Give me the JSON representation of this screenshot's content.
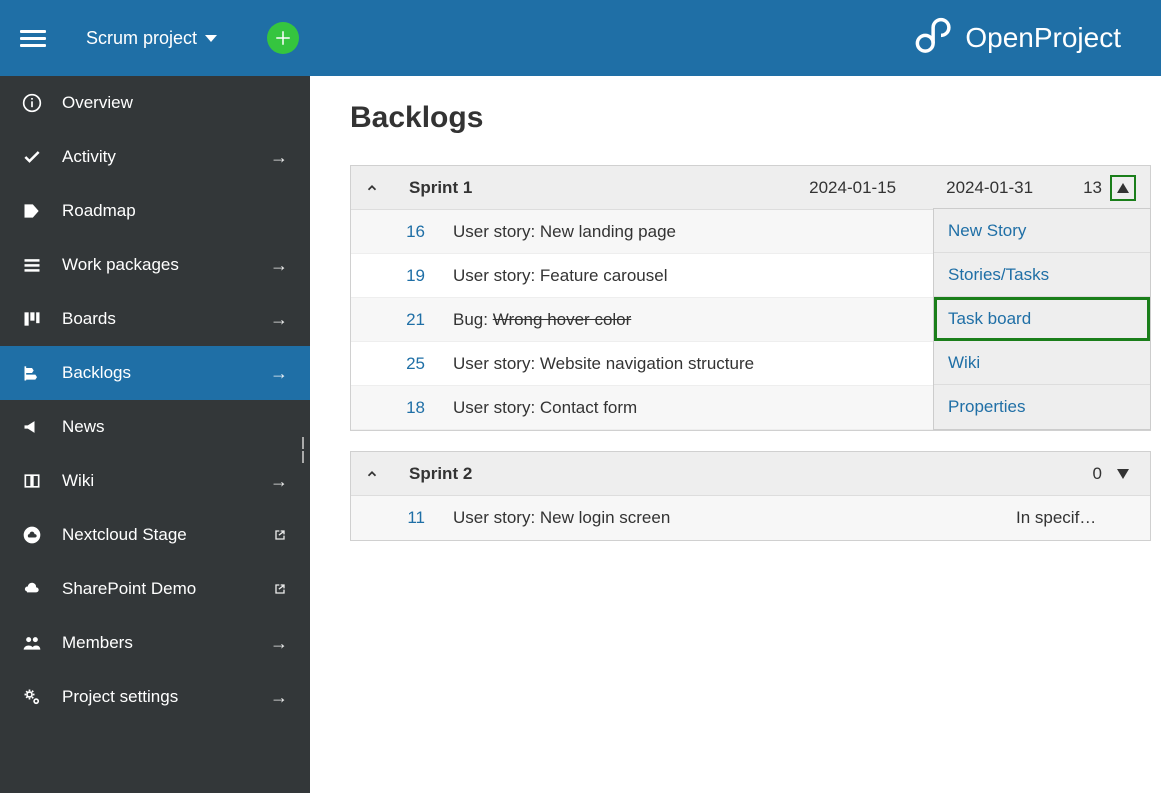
{
  "header": {
    "project_name": "Scrum project",
    "brand": "OpenProject"
  },
  "sidebar": {
    "items": [
      {
        "label": "Overview",
        "icon": "info",
        "trailing": ""
      },
      {
        "label": "Activity",
        "icon": "check",
        "trailing": "arrow"
      },
      {
        "label": "Roadmap",
        "icon": "tag",
        "trailing": ""
      },
      {
        "label": "Work packages",
        "icon": "list",
        "trailing": "arrow"
      },
      {
        "label": "Boards",
        "icon": "board",
        "trailing": "arrow"
      },
      {
        "label": "Backlogs",
        "icon": "backlog",
        "trailing": "arrow",
        "active": true
      },
      {
        "label": "News",
        "icon": "megaphone",
        "trailing": ""
      },
      {
        "label": "Wiki",
        "icon": "book",
        "trailing": "arrow"
      },
      {
        "label": "Nextcloud Stage",
        "icon": "cloud-circle",
        "trailing": "external"
      },
      {
        "label": "SharePoint Demo",
        "icon": "cloud",
        "trailing": "external"
      },
      {
        "label": "Members",
        "icon": "people",
        "trailing": "arrow"
      },
      {
        "label": "Project settings",
        "icon": "gears",
        "trailing": "arrow"
      }
    ]
  },
  "page": {
    "title": "Backlogs"
  },
  "sprints": [
    {
      "name": "Sprint 1",
      "start": "2024-01-15",
      "end": "2024-01-31",
      "points": "13",
      "menu_open": true,
      "items": [
        {
          "id": "16",
          "title": "User story: New landing page",
          "strike": false,
          "status": ""
        },
        {
          "id": "19",
          "title": "User story: Feature carousel",
          "strike": false,
          "status": ""
        },
        {
          "id": "21",
          "title_prefix": "Bug: ",
          "title": "Wrong hover color",
          "strike": true,
          "status": ""
        },
        {
          "id": "25",
          "title": "User story: Website navigation structure",
          "strike": false,
          "status": ""
        },
        {
          "id": "18",
          "title": "User story: Contact form",
          "strike": false,
          "status": ""
        }
      ]
    },
    {
      "name": "Sprint 2",
      "start": "",
      "end": "",
      "points": "0",
      "menu_open": false,
      "items": [
        {
          "id": "11",
          "title": "User story: New login screen",
          "strike": false,
          "status": "In specif…"
        }
      ]
    }
  ],
  "dropdown": {
    "items": [
      "New Story",
      "Stories/Tasks",
      "Task board",
      "Wiki",
      "Properties"
    ],
    "highlighted_index": 2
  }
}
